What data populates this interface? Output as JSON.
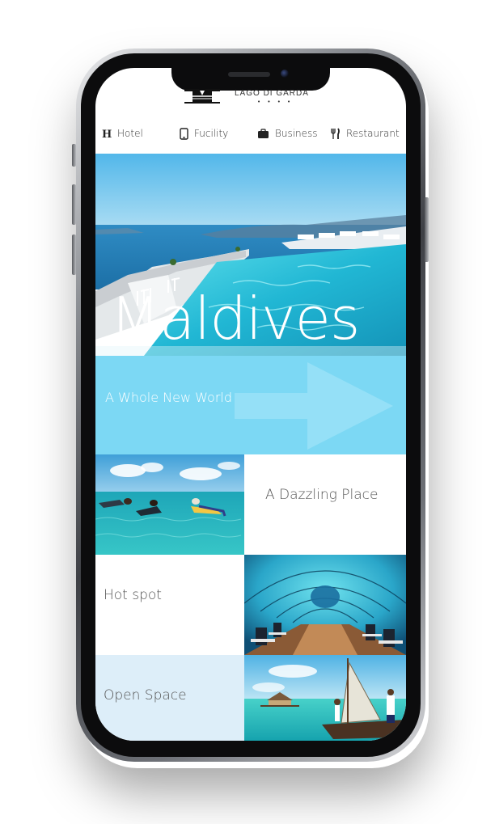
{
  "brand": {
    "name": "LAGO DI GARDA",
    "dots": "• • • •"
  },
  "nav": {
    "items": [
      {
        "label": "Hotel",
        "icon": "hotel-h-icon"
      },
      {
        "label": "Fucility",
        "icon": "phone-device-icon"
      },
      {
        "label": "Business",
        "icon": "briefcase-icon"
      },
      {
        "label": "Restaurant",
        "icon": "fork-knife-icon"
      }
    ]
  },
  "hero": {
    "title": "Maldives"
  },
  "banner": {
    "tagline": "A Whole New World",
    "accent_color": "#7cd8f4"
  },
  "tiles": {
    "dazzling": "A Dazzling Place",
    "hotspot": "Hot spot",
    "openspace": "Open Space"
  },
  "colors": {
    "sea": "#2bb8d6",
    "sky": "#6fc6f2",
    "text": "#555555"
  }
}
